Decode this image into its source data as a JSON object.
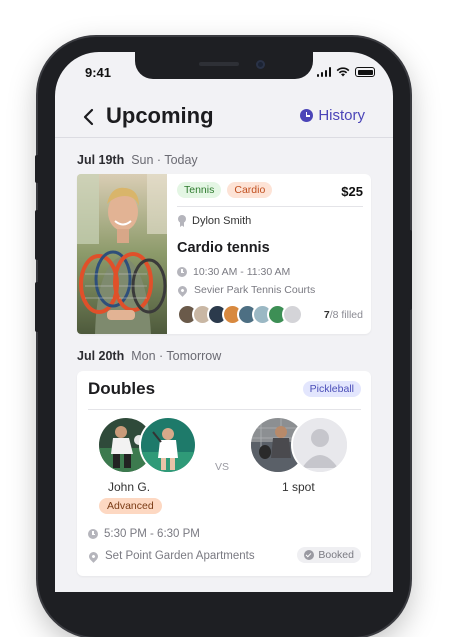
{
  "status_bar": {
    "time": "9:41"
  },
  "header": {
    "title": "Upcoming",
    "history_label": "History"
  },
  "sections": [
    {
      "date": "Jul 19th",
      "day": "Sun · Today",
      "event": {
        "tags": [
          "Tennis",
          "Cardio"
        ],
        "price": "$25",
        "coach": "Dylon Smith",
        "title": "Cardio tennis",
        "time": "10:30 AM - 11:30 AM",
        "location": "Sevier Park Tennis Courts",
        "filled_count": "7",
        "filled_rest": "/8 filled",
        "attendee_colors": [
          "#6a5a4a",
          "#c9b7a4",
          "#2b3a4c",
          "#d8893f",
          "#4d6f83",
          "#9bb8c4",
          "#3d8f55",
          "#d4d4d8"
        ]
      }
    },
    {
      "date": "Jul 20th",
      "day": "Mon · Tomorrow",
      "event": {
        "title": "Doubles",
        "sport_tag": "Pickleball",
        "vs_label": "VS",
        "team_a_name": "John G.",
        "team_a_level": "Advanced",
        "team_b_name": "1 spot",
        "time": "5:30 PM - 6:30 PM",
        "location": "Set Point Garden Apartments",
        "status": "Booked"
      }
    }
  ],
  "colors": {
    "accent": "#4b45b8",
    "background": "#f2f2f5"
  }
}
